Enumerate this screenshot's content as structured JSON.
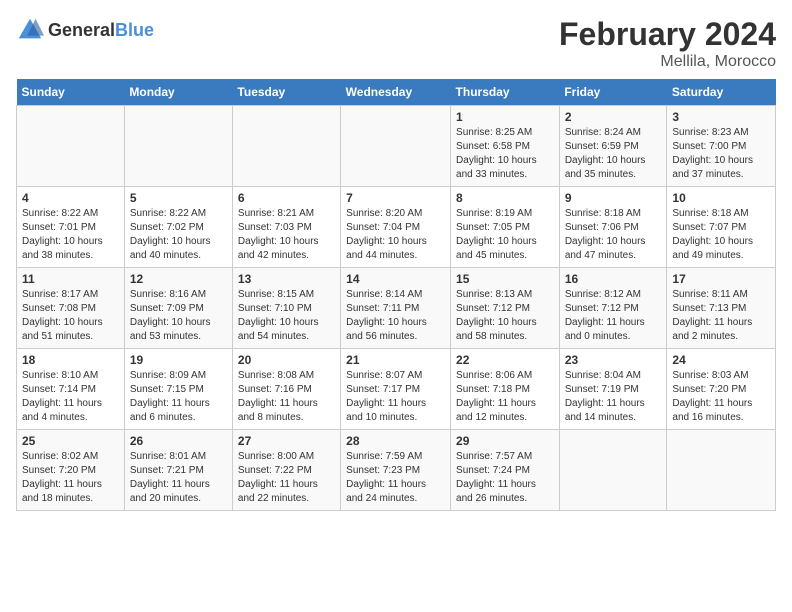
{
  "header": {
    "logo_general": "General",
    "logo_blue": "Blue",
    "title": "February 2024",
    "subtitle": "Mellila, Morocco"
  },
  "weekdays": [
    "Sunday",
    "Monday",
    "Tuesday",
    "Wednesday",
    "Thursday",
    "Friday",
    "Saturday"
  ],
  "weeks": [
    [
      {
        "day": "",
        "info": ""
      },
      {
        "day": "",
        "info": ""
      },
      {
        "day": "",
        "info": ""
      },
      {
        "day": "",
        "info": ""
      },
      {
        "day": "1",
        "info": "Sunrise: 8:25 AM\nSunset: 6:58 PM\nDaylight: 10 hours\nand 33 minutes."
      },
      {
        "day": "2",
        "info": "Sunrise: 8:24 AM\nSunset: 6:59 PM\nDaylight: 10 hours\nand 35 minutes."
      },
      {
        "day": "3",
        "info": "Sunrise: 8:23 AM\nSunset: 7:00 PM\nDaylight: 10 hours\nand 37 minutes."
      }
    ],
    [
      {
        "day": "4",
        "info": "Sunrise: 8:22 AM\nSunset: 7:01 PM\nDaylight: 10 hours\nand 38 minutes."
      },
      {
        "day": "5",
        "info": "Sunrise: 8:22 AM\nSunset: 7:02 PM\nDaylight: 10 hours\nand 40 minutes."
      },
      {
        "day": "6",
        "info": "Sunrise: 8:21 AM\nSunset: 7:03 PM\nDaylight: 10 hours\nand 42 minutes."
      },
      {
        "day": "7",
        "info": "Sunrise: 8:20 AM\nSunset: 7:04 PM\nDaylight: 10 hours\nand 44 minutes."
      },
      {
        "day": "8",
        "info": "Sunrise: 8:19 AM\nSunset: 7:05 PM\nDaylight: 10 hours\nand 45 minutes."
      },
      {
        "day": "9",
        "info": "Sunrise: 8:18 AM\nSunset: 7:06 PM\nDaylight: 10 hours\nand 47 minutes."
      },
      {
        "day": "10",
        "info": "Sunrise: 8:18 AM\nSunset: 7:07 PM\nDaylight: 10 hours\nand 49 minutes."
      }
    ],
    [
      {
        "day": "11",
        "info": "Sunrise: 8:17 AM\nSunset: 7:08 PM\nDaylight: 10 hours\nand 51 minutes."
      },
      {
        "day": "12",
        "info": "Sunrise: 8:16 AM\nSunset: 7:09 PM\nDaylight: 10 hours\nand 53 minutes."
      },
      {
        "day": "13",
        "info": "Sunrise: 8:15 AM\nSunset: 7:10 PM\nDaylight: 10 hours\nand 54 minutes."
      },
      {
        "day": "14",
        "info": "Sunrise: 8:14 AM\nSunset: 7:11 PM\nDaylight: 10 hours\nand 56 minutes."
      },
      {
        "day": "15",
        "info": "Sunrise: 8:13 AM\nSunset: 7:12 PM\nDaylight: 10 hours\nand 58 minutes."
      },
      {
        "day": "16",
        "info": "Sunrise: 8:12 AM\nSunset: 7:12 PM\nDaylight: 11 hours\nand 0 minutes."
      },
      {
        "day": "17",
        "info": "Sunrise: 8:11 AM\nSunset: 7:13 PM\nDaylight: 11 hours\nand 2 minutes."
      }
    ],
    [
      {
        "day": "18",
        "info": "Sunrise: 8:10 AM\nSunset: 7:14 PM\nDaylight: 11 hours\nand 4 minutes."
      },
      {
        "day": "19",
        "info": "Sunrise: 8:09 AM\nSunset: 7:15 PM\nDaylight: 11 hours\nand 6 minutes."
      },
      {
        "day": "20",
        "info": "Sunrise: 8:08 AM\nSunset: 7:16 PM\nDaylight: 11 hours\nand 8 minutes."
      },
      {
        "day": "21",
        "info": "Sunrise: 8:07 AM\nSunset: 7:17 PM\nDaylight: 11 hours\nand 10 minutes."
      },
      {
        "day": "22",
        "info": "Sunrise: 8:06 AM\nSunset: 7:18 PM\nDaylight: 11 hours\nand 12 minutes."
      },
      {
        "day": "23",
        "info": "Sunrise: 8:04 AM\nSunset: 7:19 PM\nDaylight: 11 hours\nand 14 minutes."
      },
      {
        "day": "24",
        "info": "Sunrise: 8:03 AM\nSunset: 7:20 PM\nDaylight: 11 hours\nand 16 minutes."
      }
    ],
    [
      {
        "day": "25",
        "info": "Sunrise: 8:02 AM\nSunset: 7:20 PM\nDaylight: 11 hours\nand 18 minutes."
      },
      {
        "day": "26",
        "info": "Sunrise: 8:01 AM\nSunset: 7:21 PM\nDaylight: 11 hours\nand 20 minutes."
      },
      {
        "day": "27",
        "info": "Sunrise: 8:00 AM\nSunset: 7:22 PM\nDaylight: 11 hours\nand 22 minutes."
      },
      {
        "day": "28",
        "info": "Sunrise: 7:59 AM\nSunset: 7:23 PM\nDaylight: 11 hours\nand 24 minutes."
      },
      {
        "day": "29",
        "info": "Sunrise: 7:57 AM\nSunset: 7:24 PM\nDaylight: 11 hours\nand 26 minutes."
      },
      {
        "day": "",
        "info": ""
      },
      {
        "day": "",
        "info": ""
      }
    ]
  ]
}
